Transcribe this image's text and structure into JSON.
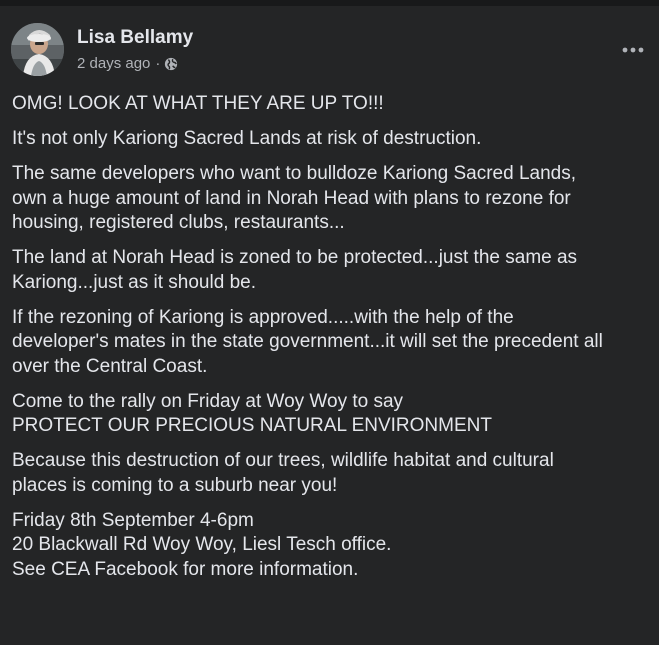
{
  "post": {
    "author": "Lisa Bellamy",
    "timestamp": "2 days ago",
    "separator": "·",
    "audience_icon": "globe-icon",
    "more_icon": "more-options-icon",
    "paragraphs": [
      [
        "OMG! LOOK AT WHAT THEY ARE UP TO!!!"
      ],
      [
        "It's not only Kariong Sacred Lands at risk of destruction."
      ],
      [
        "The same developers who want to bulldoze Kariong Sacred Lands,",
        "own a huge amount of land in Norah Head with plans to rezone for",
        "housing, registered clubs, restaurants..."
      ],
      [
        "The land at Norah Head is zoned to be protected...just the same as",
        "Kariong...just as it should be."
      ],
      [
        "If the rezoning of Kariong is approved.....with the help of the",
        "developer's mates in the state government...it will set the precedent all",
        "over the Central Coast."
      ],
      [
        "Come to the rally on Friday at Woy Woy to say",
        "PROTECT OUR PRECIOUS NATURAL ENVIRONMENT"
      ],
      [
        "Because this destruction of our trees, wildlife habitat and cultural",
        "places is coming to a suburb near you!"
      ],
      [
        "Friday 8th September 4-6pm",
        "20 Blackwall Rd Woy Woy, Liesl Tesch office.",
        "See CEA Facebook for more information."
      ]
    ]
  },
  "colors": {
    "page_bg": "#18191a",
    "card_bg": "#242526",
    "primary_text": "#e4e6eb",
    "secondary_text": "#b0b3b8"
  }
}
